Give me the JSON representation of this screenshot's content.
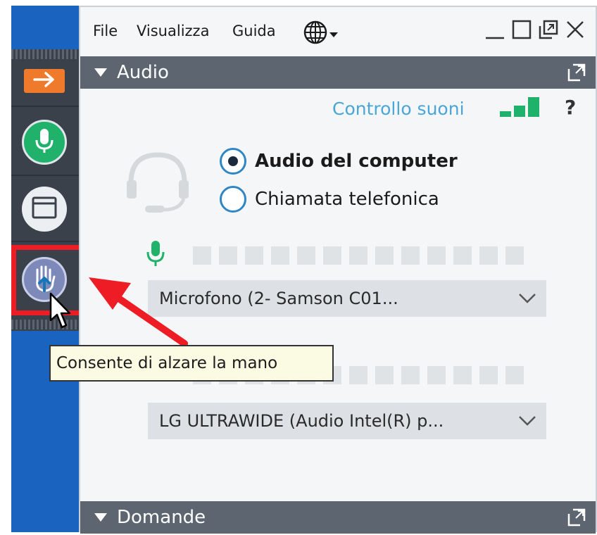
{
  "menu": {
    "file": "File",
    "view": "Visualizza",
    "help": "Guida"
  },
  "audio_section": {
    "title": "Audio",
    "sound_check_link": "Controllo suoni",
    "help_symbol": "?",
    "options": [
      {
        "label": "Audio del computer",
        "selected": true
      },
      {
        "label": "Chiamata telefonica",
        "selected": false
      }
    ],
    "microphone": "Microfono (2- Samson C01...",
    "speaker": "LG ULTRAWIDE (Audio Intel(R) p..."
  },
  "questions_section": {
    "title": "Domande"
  },
  "tooltip": "Consente di alzare la mano",
  "icons": {
    "toolbar": [
      "arrow-right-icon",
      "microphone-icon",
      "window-icon",
      "raise-hand-icon"
    ],
    "window": [
      "globe-icon",
      "minimize-icon",
      "maximize-icon",
      "restore-icon",
      "close-icon",
      "popout-icon"
    ]
  },
  "colors": {
    "accent_blue": "#1a64c0",
    "orange": "#f07a2b",
    "green": "#20b26b",
    "header_gray": "#5d6670",
    "link_blue": "#4aa6d8",
    "highlight_red": "#ee1c24",
    "tooltip_bg": "#fbfbe3"
  }
}
